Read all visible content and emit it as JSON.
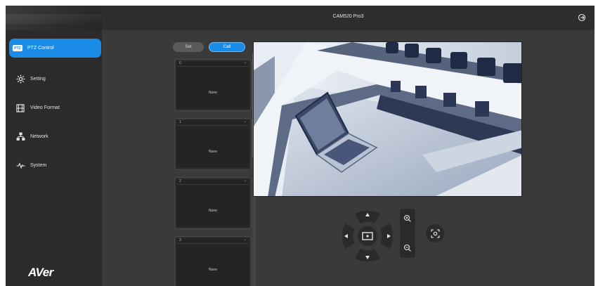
{
  "header": {
    "title": "CAM520 Pro3"
  },
  "sidebar": {
    "items": [
      {
        "label": "PTZ Control",
        "icon": "ptz-icon"
      },
      {
        "label": "Setting",
        "icon": "gear-icon"
      },
      {
        "label": "Video Format",
        "icon": "film-icon"
      },
      {
        "label": "Network",
        "icon": "network-icon"
      },
      {
        "label": "System",
        "icon": "pulse-icon"
      }
    ],
    "logo": "AVer",
    "active_icon_text": "PTZ"
  },
  "presets": {
    "set_label": "Set",
    "call_label": "Call",
    "cards": [
      {
        "number": "0",
        "name": "None"
      },
      {
        "number": "1",
        "name": "None"
      },
      {
        "number": "2",
        "name": "None"
      },
      {
        "number": "3",
        "name": "None"
      }
    ],
    "chevron": "⌄"
  },
  "colors": {
    "accent": "#1a8be6",
    "background": "#3a3a3a",
    "sidebar": "#2b2b2b"
  }
}
